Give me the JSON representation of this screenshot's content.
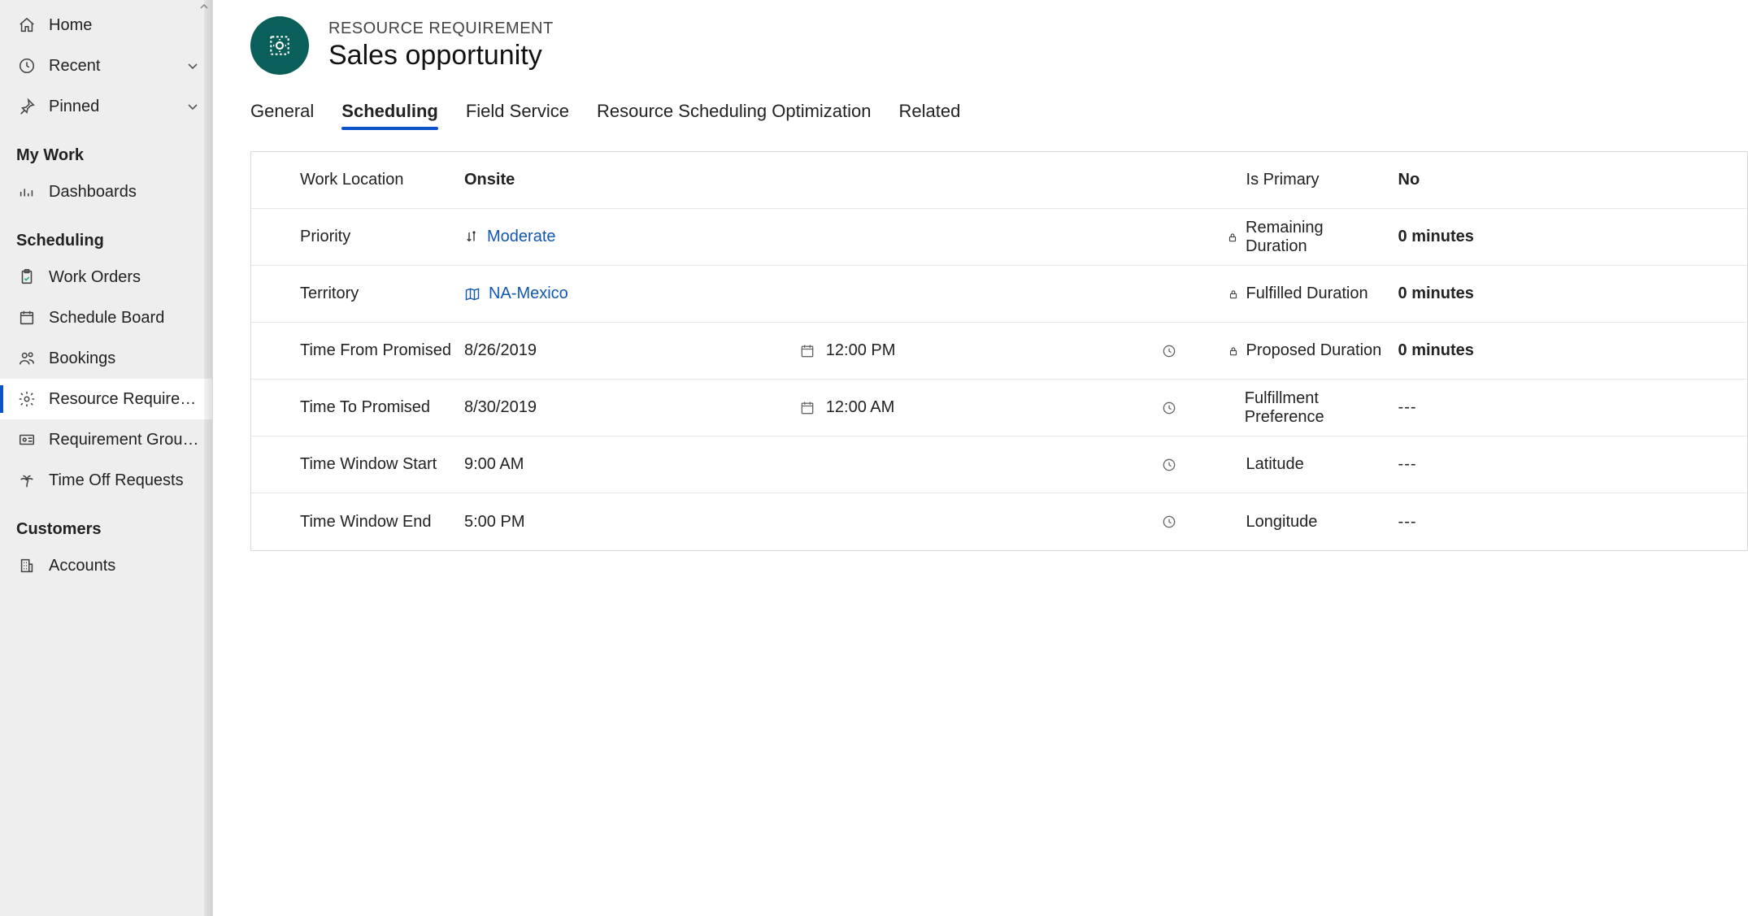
{
  "sidebar": {
    "top": [
      {
        "label": "Home",
        "icon": "home",
        "exp": false
      },
      {
        "label": "Recent",
        "icon": "clock",
        "exp": true
      },
      {
        "label": "Pinned",
        "icon": "pin",
        "exp": true
      }
    ],
    "groups": [
      {
        "heading": "My Work",
        "items": [
          {
            "label": "Dashboards",
            "icon": "dashboard"
          }
        ]
      },
      {
        "heading": "Scheduling",
        "items": [
          {
            "label": "Work Orders",
            "icon": "clipboard"
          },
          {
            "label": "Schedule Board",
            "icon": "calendar"
          },
          {
            "label": "Bookings",
            "icon": "people"
          },
          {
            "label": "Resource Require…",
            "icon": "gear",
            "active": true
          },
          {
            "label": "Requirement Grou…",
            "icon": "idcard"
          },
          {
            "label": "Time Off Requests",
            "icon": "palm"
          }
        ]
      },
      {
        "heading": "Customers",
        "items": [
          {
            "label": "Accounts",
            "icon": "building"
          }
        ]
      }
    ]
  },
  "header": {
    "eyebrow": "RESOURCE REQUIREMENT",
    "title": "Sales opportunity"
  },
  "tabs": [
    {
      "label": "General"
    },
    {
      "label": "Scheduling",
      "active": true
    },
    {
      "label": "Field Service"
    },
    {
      "label": "Resource Scheduling Optimization"
    },
    {
      "label": "Related"
    }
  ],
  "fields_left": [
    {
      "label": "Work Location",
      "value": "Onsite",
      "bold": true
    },
    {
      "label": "Priority",
      "value": "Moderate",
      "link": true,
      "preicon": "sort"
    },
    {
      "label": "Territory",
      "value": "NA-Mexico",
      "link": true,
      "preicon": "map"
    },
    {
      "label": "Time From Promised",
      "value": "8/26/2019",
      "suffix": "calendar",
      "value2": "12:00 PM",
      "suffix2": "clock"
    },
    {
      "label": "Time To Promised",
      "value": "8/30/2019",
      "suffix": "calendar",
      "value2": "12:00 AM",
      "suffix2": "clock"
    },
    {
      "label": "Time Window Start",
      "value": "9:00 AM",
      "suffix2": "clock"
    },
    {
      "label": "Time Window End",
      "value": "5:00 PM",
      "suffix2": "clock"
    }
  ],
  "fields_right": [
    {
      "label": "Is Primary",
      "value": "No",
      "bold": true
    },
    {
      "label": "Remaining Duration",
      "value": "0 minutes",
      "bold": true,
      "locked": true
    },
    {
      "label": "Fulfilled Duration",
      "value": "0 minutes",
      "bold": true,
      "locked": true
    },
    {
      "label": "Proposed Duration",
      "value": "0 minutes",
      "bold": true,
      "locked": true
    },
    {
      "label": "Fulfillment Preference",
      "value": "---"
    },
    {
      "label": "Latitude",
      "value": "---"
    },
    {
      "label": "Longitude",
      "value": "---"
    }
  ]
}
